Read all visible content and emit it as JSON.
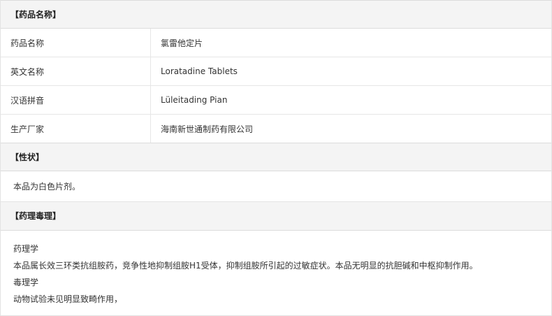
{
  "sections": {
    "name": {
      "header": "【药品名称】",
      "rows": [
        {
          "label": "药品名称",
          "value": "氯雷他定片"
        },
        {
          "label": "英文名称",
          "value": "Loratadine Tablets"
        },
        {
          "label": "汉语拼音",
          "value": "Lüleitading Pian"
        },
        {
          "label": "生产厂家",
          "value": "海南新世通制药有限公司"
        }
      ]
    },
    "character": {
      "header": "【性状】",
      "text": "本品为白色片剂。"
    },
    "pharmacology": {
      "header": "【药理毒理】",
      "lines": [
        "药理学",
        "本品属长效三环类抗组胺药，竞争性地抑制组胺H1受体，抑制组胺所引起的过敏症状。本品无明显的抗胆碱和中枢抑制作用。",
        "毒理学",
        "动物试验未见明显致畸作用，"
      ]
    }
  }
}
